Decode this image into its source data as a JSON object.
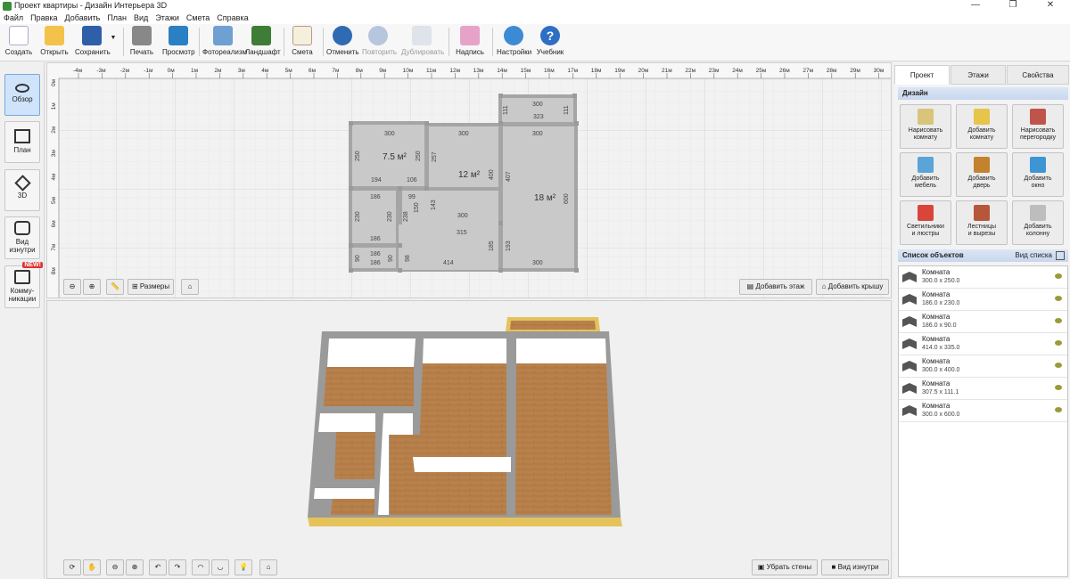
{
  "window": {
    "title": "Проект квартиры - Дизайн Интерьера 3D",
    "minimize": "—",
    "restore": "❐",
    "close": "✕"
  },
  "menu": [
    "Файл",
    "Правка",
    "Добавить",
    "План",
    "Вид",
    "Этажи",
    "Смета",
    "Справка"
  ],
  "toolbar": {
    "create": "Создать",
    "open": "Открыть",
    "save": "Сохранить",
    "save_arrow": "▼",
    "print": "Печать",
    "preview": "Просмотр",
    "photorealism": "Фотореализм",
    "landscape": "Ландшафт",
    "estimate": "Смета",
    "undo": "Отменить",
    "redo": "Повторить",
    "duplicate": "Дублировать",
    "label": "Надпись",
    "settings": "Настройки",
    "tutorial": "Учебник"
  },
  "sidebar": {
    "overview": "Обзор",
    "plan": "План",
    "view3d": "3D",
    "inside_line1": "Вид",
    "inside_line2": "изнутри",
    "comm_line1": "Комму-",
    "comm_line2": "никации",
    "new_badge": "NEW!"
  },
  "plan": {
    "ruler_top": [
      "-4м",
      "-3м",
      "-2м",
      "-1м",
      "0м",
      "1м",
      "2м",
      "3м",
      "4м",
      "5м",
      "6м",
      "7м",
      "8м",
      "9м",
      "10м",
      "11м",
      "12м",
      "13м",
      "14м",
      "15м",
      "16м",
      "17м",
      "18м",
      "19м",
      "20м",
      "21м",
      "22м",
      "23м",
      "24м",
      "25м",
      "26м",
      "27м",
      "28м",
      "29м",
      "30м"
    ],
    "ruler_left": [
      "0м",
      "1м",
      "2м",
      "3м",
      "4м",
      "5м",
      "6м",
      "7м",
      "8м"
    ],
    "rooms": {
      "area_1": "7.5 м²",
      "area_2": "12 м²",
      "area_3": "18 м²"
    },
    "dims": {
      "d300a": "300",
      "d300b": "300",
      "d300c": "300",
      "d300d": "300",
      "d300e": "300",
      "d300f": "300",
      "d323": "323",
      "d111a": "111",
      "d111b": "111",
      "d250a": "250",
      "d250b": "250",
      "d257": "257",
      "d194": "194",
      "d106": "106",
      "d400": "400",
      "d407": "407",
      "d600": "600",
      "d186a": "186",
      "d186b": "186",
      "d186c": "186",
      "d186d": "186",
      "d99": "99",
      "d150": "150",
      "d143": "143",
      "d230a": "230",
      "d230b": "230",
      "d238": "238",
      "d315": "315",
      "d185": "185",
      "d193": "193",
      "d90a": "90",
      "d90b": "90",
      "d98": "98",
      "d414": "414"
    },
    "dimensions_btn": "Размеры",
    "add_floor": "Добавить этаж",
    "add_roof": "Добавить крышу"
  },
  "view3d": {
    "remove_walls": "Убрать стены",
    "inside_view": "Вид изнутри"
  },
  "rightpanel": {
    "tabs": [
      "Проект",
      "Этажи",
      "Свойства"
    ],
    "design_header": "Дизайн",
    "design_buttons": [
      {
        "l1": "Нарисовать",
        "l2": "комнату"
      },
      {
        "l1": "Добавить",
        "l2": "комнату"
      },
      {
        "l1": "Нарисовать",
        "l2": "перегородку"
      },
      {
        "l1": "Добавить",
        "l2": "мебель"
      },
      {
        "l1": "Добавить",
        "l2": "дверь"
      },
      {
        "l1": "Добавить",
        "l2": "окно"
      },
      {
        "l1": "Светильники",
        "l2": "и люстры"
      },
      {
        "l1": "Лестницы",
        "l2": "и вырезы"
      },
      {
        "l1": "Добавить",
        "l2": "колонну"
      }
    ],
    "objects_header": "Список объектов",
    "list_view": "Вид списка",
    "objects": [
      {
        "name": "Комната",
        "size": "300.0 x 250.0"
      },
      {
        "name": "Комната",
        "size": "186.0 x 230.0"
      },
      {
        "name": "Комната",
        "size": "186.0 x 90.0"
      },
      {
        "name": "Комната",
        "size": "414.0 x 335.0"
      },
      {
        "name": "Комната",
        "size": "300.0 x 400.0"
      },
      {
        "name": "Комната",
        "size": "307.5 x 111.1"
      },
      {
        "name": "Комната",
        "size": "300.0 x 600.0"
      }
    ]
  },
  "colors": {
    "accent": "#cfe3fb",
    "floor_wood": "#b8804a",
    "wall_top": "#9a9a9a",
    "room_fill": "#c9c9c9",
    "grid": "#d9d9d9"
  }
}
